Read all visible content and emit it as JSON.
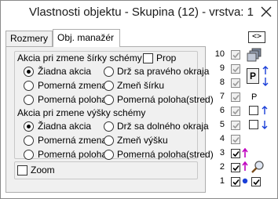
{
  "window": {
    "title": "Vlastnosti objektu - Skupina (12) - vrstva: 1"
  },
  "tabs": [
    {
      "label": "Rozmery",
      "active": false
    },
    {
      "label": "Obj. manažér",
      "active": true
    }
  ],
  "width_section": {
    "heading": "Akcia pri zmene šírky schémy",
    "prop_label": "Prop",
    "prop_checked": false,
    "options": [
      "Žiadna akcia",
      "Drž sa pravého okraja",
      "Pomerná zmena",
      "Zmeň šírku",
      "Pomerná poloha",
      "Pomerná poloha(stred)"
    ],
    "selected": "Žiadna akcia"
  },
  "height_section": {
    "heading": "Akcia pri zmene výšky schémy",
    "options": [
      "Žiadna akcia",
      "Drž sa dolného okraja",
      "Pomerná zmena",
      "Zmeň výšku",
      "Pomerná poloha",
      "Pomerná poloha(stred)"
    ],
    "selected": "Žiadna akcia"
  },
  "zoom": {
    "label": "Zoom",
    "checked": false
  },
  "toolbar": {
    "swap_button_label": "<>"
  },
  "layers": {
    "numbers": [
      "10",
      "9",
      "8",
      "7",
      "6",
      "5",
      "4",
      "3",
      "2",
      "1"
    ],
    "p_label_top": "P",
    "p_label_mid": "P"
  },
  "colors": {
    "accent_magenta": "#c000c0",
    "accent_blue": "#1a3fd8",
    "check_gray": "#9a9a9a"
  }
}
